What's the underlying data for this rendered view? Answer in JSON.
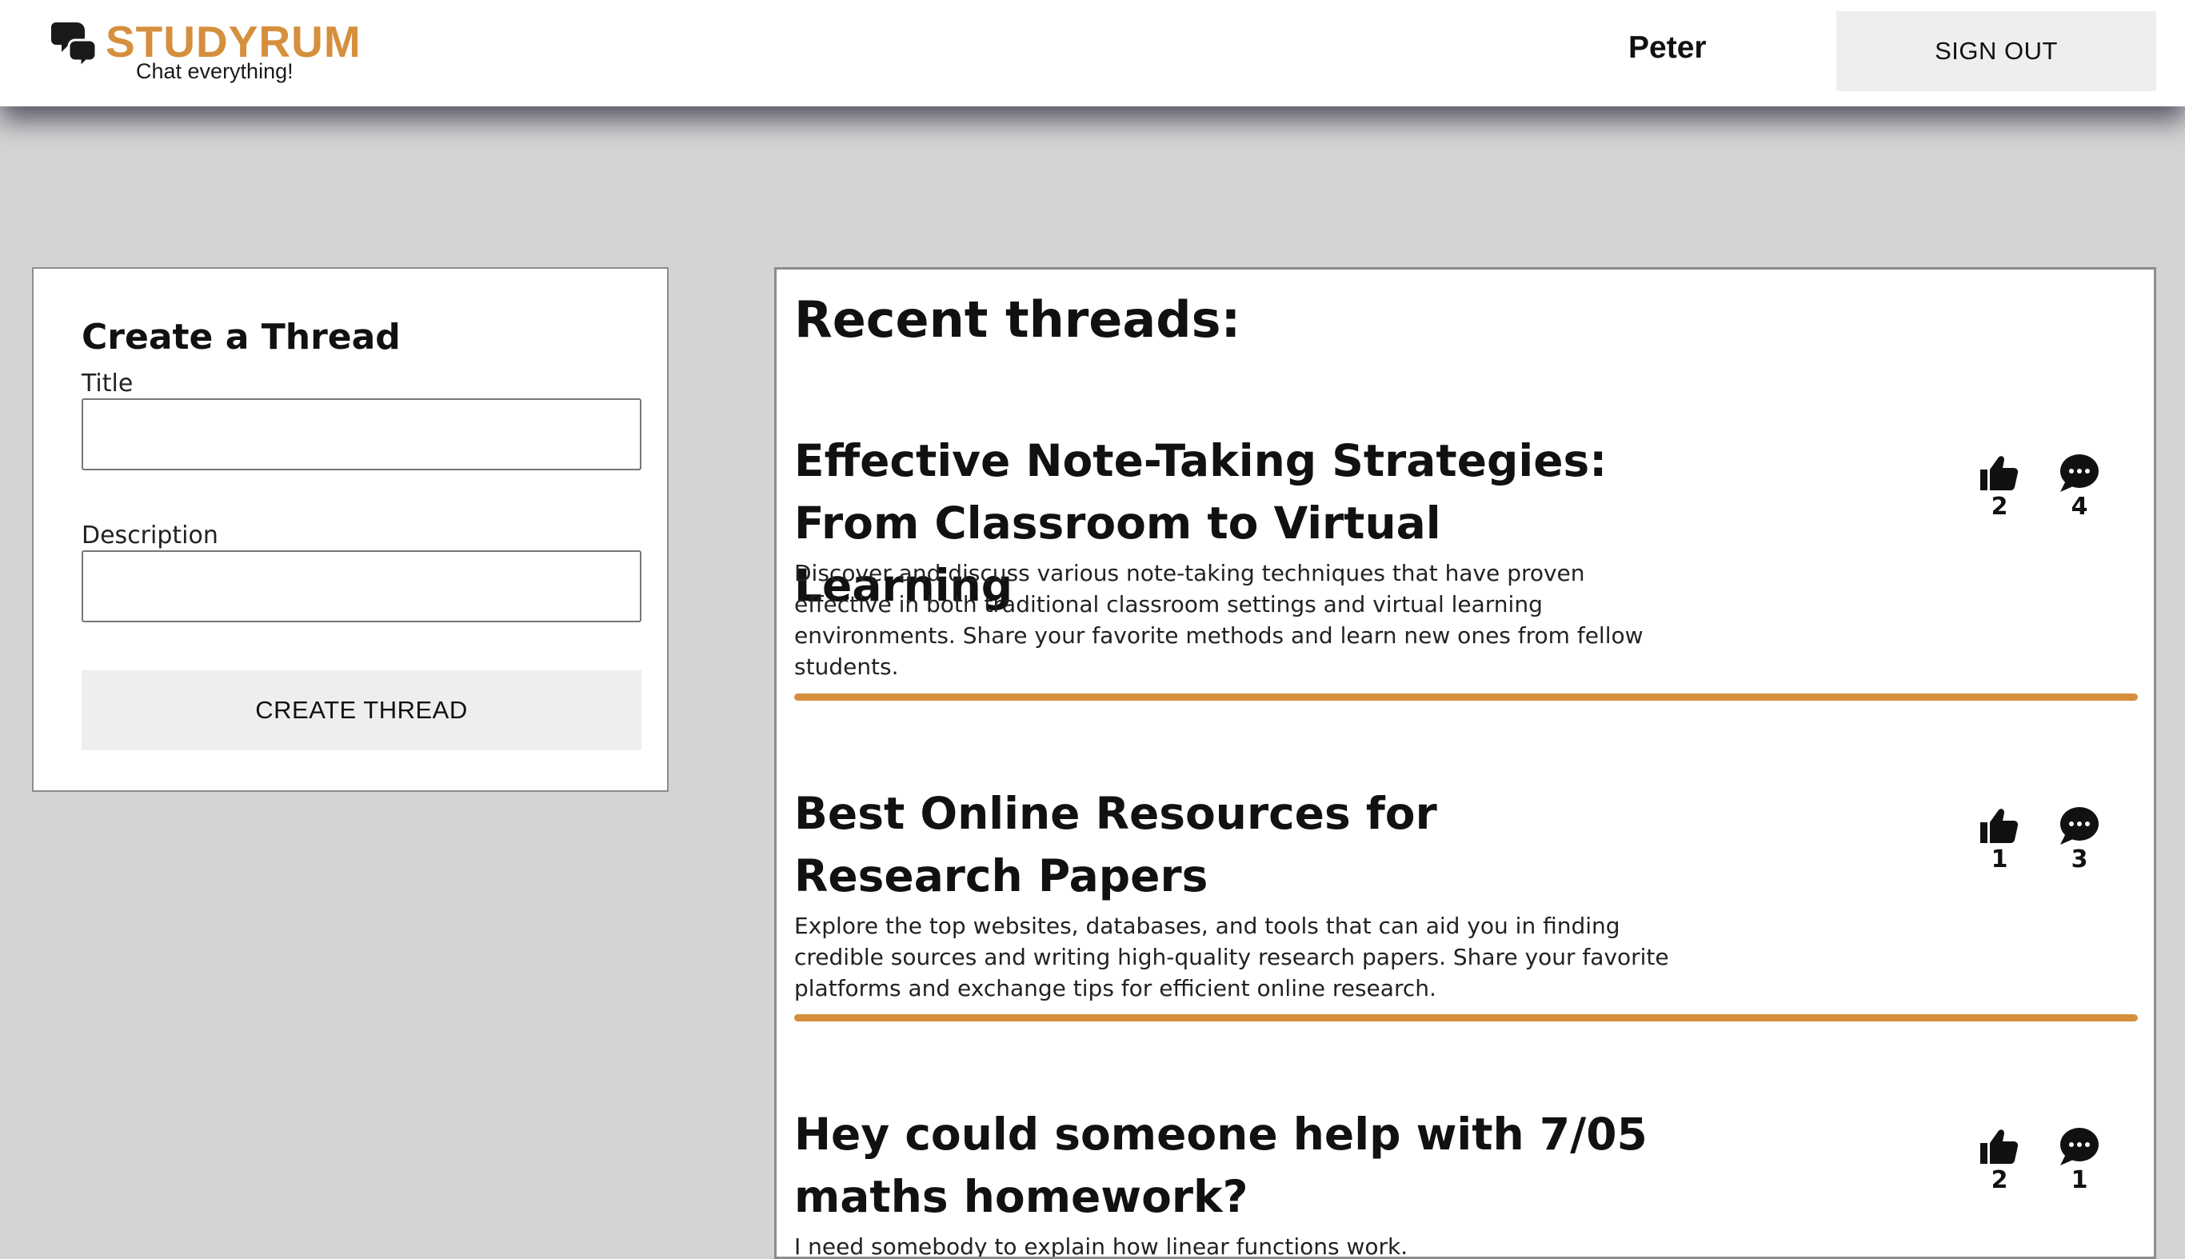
{
  "header": {
    "logo_title": "STUDYRUM",
    "logo_tagline": "Chat everything!",
    "user_name": "Peter",
    "signout_label": "SIGN OUT"
  },
  "create_thread": {
    "heading": "Create a Thread",
    "title_label": "Title",
    "title_value": "",
    "description_label": "Description",
    "description_value": "",
    "button_label": "CREATE THREAD"
  },
  "recent": {
    "heading": "Recent threads:",
    "threads": [
      {
        "title": "Effective Note-Taking Strategies: From Classroom to Virtual Learning",
        "description": "Discover and discuss various note-taking techniques that have proven effective in both traditional classroom settings and virtual learning environments. Share your favorite methods and learn new ones from fellow students.",
        "likes": "2",
        "comments": "4"
      },
      {
        "title": "Best Online Resources for Research Papers",
        "description": "Explore the top websites, databases, and tools that can aid you in finding credible sources and writing high-quality research papers. Share your favorite platforms and exchange tips for efficient online research.",
        "likes": "1",
        "comments": "3"
      },
      {
        "title": "Hey could someone help with 7/05 maths homework?",
        "description": "I need somebody to explain how linear functions work.",
        "likes": "2",
        "comments": "1"
      }
    ]
  },
  "icons": {
    "logo": "chat-bubbles-icon",
    "like": "thumbs-up-icon",
    "comment": "comment-bubble-icon"
  },
  "colors": {
    "accent": "#d58f3d",
    "background": "#d4d4d4",
    "button": "#eeeeee"
  }
}
